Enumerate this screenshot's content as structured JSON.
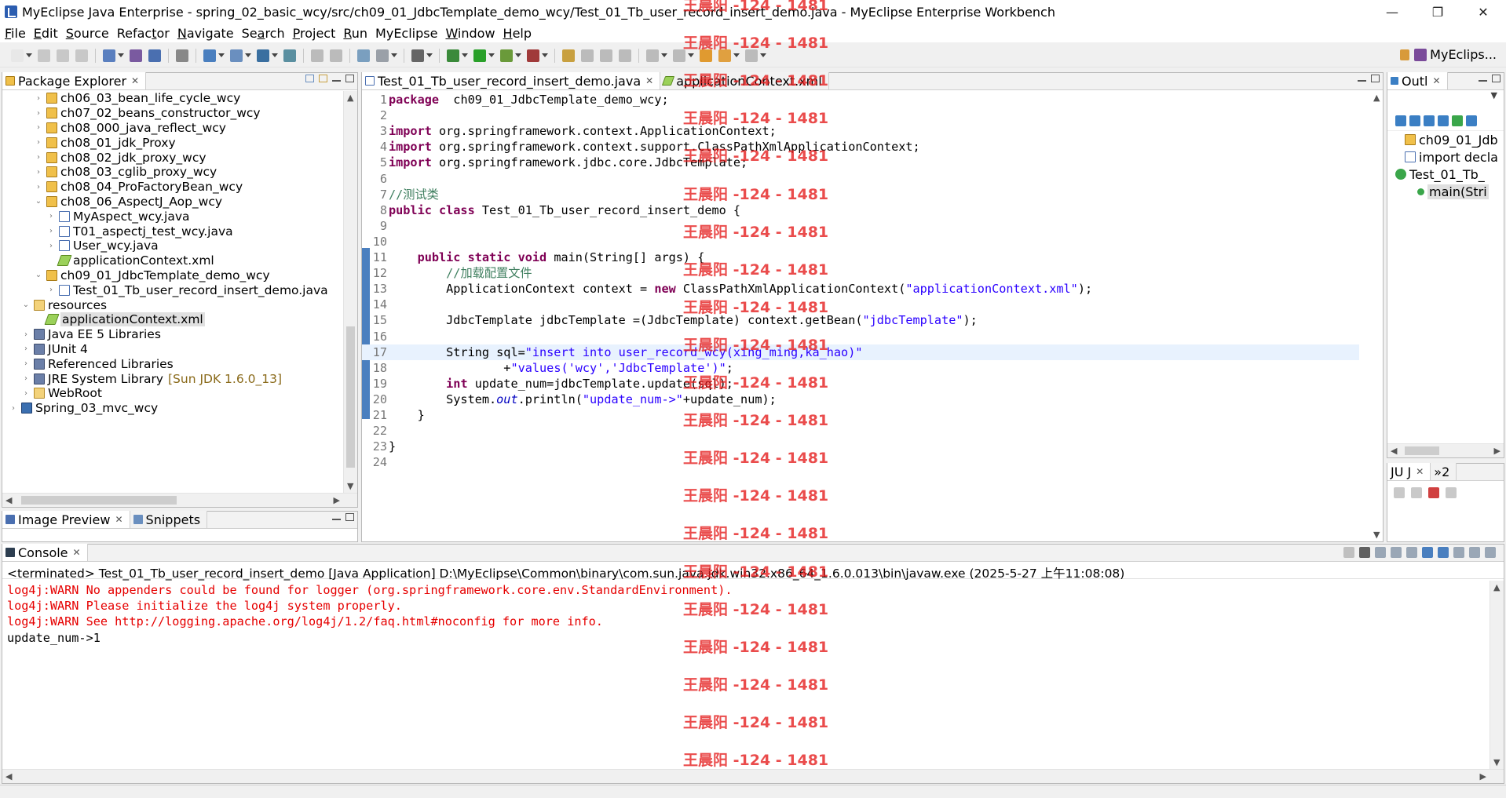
{
  "window": {
    "title": "MyEclipse Java Enterprise - spring_02_basic_wcy/src/ch09_01_JdbcTemplate_demo_wcy/Test_01_Tb_user_record_insert_demo.java - MyEclipse Enterprise Workbench",
    "minimize": "—",
    "restore": "❐",
    "close": "✕"
  },
  "menu": [
    {
      "mn": "F",
      "rest": "ile"
    },
    {
      "mn": "E",
      "rest": "dit"
    },
    {
      "mn": "S",
      "rest": "ource"
    },
    {
      "mn": "",
      "pre": "Refac",
      "mnm": "t",
      "post": "or",
      "rest": ""
    },
    {
      "mn": "N",
      "rest": "avigate"
    },
    {
      "mn": "",
      "pre": "Se",
      "mnm": "a",
      "post": "rch",
      "rest": ""
    },
    {
      "mn": "P",
      "rest": "roject"
    },
    {
      "mn": "R",
      "rest": "un"
    },
    {
      "mn": "",
      "pre": "MyEclipse",
      "mnm": "",
      "post": "",
      "rest": ""
    },
    {
      "mn": "W",
      "rest": "indow"
    },
    {
      "mn": "H",
      "rest": "elp"
    }
  ],
  "perspective": {
    "label": "MyEclips..."
  },
  "colors": {
    "keyword": "#7f0055",
    "string": "#2a00ff",
    "comment": "#3f7f5f",
    "console_warn": "#e60000",
    "watermark": "#e51b1b",
    "current_line": "#e8f2fe"
  },
  "package_explorer": {
    "tab_label": "Package Explorer",
    "items": [
      {
        "label": "ch06_03_bean_life_cycle_wcy",
        "icon": "package-icon",
        "level": 2,
        "twisty": "›"
      },
      {
        "label": "ch07_02_beans_constructor_wcy",
        "icon": "package-icon",
        "level": 2,
        "twisty": "›"
      },
      {
        "label": "ch08_000_java_reflect_wcy",
        "icon": "package-icon",
        "level": 2,
        "twisty": "›"
      },
      {
        "label": "ch08_01_jdk_Proxy",
        "icon": "package-icon",
        "level": 2,
        "twisty": "›"
      },
      {
        "label": "ch08_02_jdk_proxy_wcy",
        "icon": "package-icon",
        "level": 2,
        "twisty": "›"
      },
      {
        "label": "ch08_03_cglib_proxy_wcy",
        "icon": "package-icon",
        "level": 2,
        "twisty": "›"
      },
      {
        "label": "ch08_04_ProFactoryBean_wcy",
        "icon": "package-icon",
        "level": 2,
        "twisty": "›"
      },
      {
        "label": "ch08_06_AspectJ_Aop_wcy",
        "icon": "package-icon",
        "level": 2,
        "twisty": "⌄"
      },
      {
        "label": "MyAspect_wcy.java",
        "icon": "java-file-icon",
        "level": 3,
        "twisty": "›"
      },
      {
        "label": "T01_aspectj_test_wcy.java",
        "icon": "java-file-icon",
        "level": 3,
        "twisty": "›"
      },
      {
        "label": "User_wcy.java",
        "icon": "java-file-icon",
        "level": 3,
        "twisty": "›"
      },
      {
        "label": "applicationContext.xml",
        "icon": "xml-file-icon",
        "level": 3,
        "twisty": ""
      },
      {
        "label": "ch09_01_JdbcTemplate_demo_wcy",
        "icon": "package-icon",
        "level": 2,
        "twisty": "⌄"
      },
      {
        "label": "Test_01_Tb_user_record_insert_demo.java",
        "icon": "java-file-icon",
        "level": 3,
        "twisty": "›"
      },
      {
        "label": "resources",
        "icon": "folder-icon",
        "level": 1,
        "twisty": "⌄"
      },
      {
        "label": "applicationContext.xml",
        "icon": "xml-file-icon",
        "level": 2,
        "twisty": "",
        "selected": true
      },
      {
        "label": "Java EE 5 Libraries",
        "icon": "library-icon",
        "level": 1,
        "twisty": "›"
      },
      {
        "label": "JUnit 4",
        "icon": "library-icon",
        "level": 1,
        "twisty": "›"
      },
      {
        "label": "Referenced Libraries",
        "icon": "library-icon",
        "level": 1,
        "twisty": "›"
      },
      {
        "label": "JRE System Library",
        "extra": "[Sun JDK 1.6.0_13]",
        "icon": "library-icon",
        "level": 1,
        "twisty": "›"
      },
      {
        "label": "WebRoot",
        "icon": "folder-icon",
        "level": 1,
        "twisty": "›"
      },
      {
        "label": "Spring_03_mvc_wcy",
        "icon": "project-icon",
        "level": 0,
        "twisty": "›"
      }
    ]
  },
  "bottom_left": {
    "tabs": [
      "Image Preview",
      "Snippets"
    ]
  },
  "editor": {
    "tabs": [
      {
        "label": "Test_01_Tb_user_record_insert_demo.java",
        "active": true
      },
      {
        "label": "applicationContext.xml",
        "active": false
      }
    ],
    "current_line": 17,
    "lines": [
      {
        "n": "1",
        "segs": [
          [
            "kw",
            "package"
          ],
          [
            "",
            "  ch09_01_JdbcTemplate_demo_wcy;"
          ]
        ]
      },
      {
        "n": "2",
        "segs": []
      },
      {
        "n": "3",
        "segs": [
          [
            "kw",
            "import"
          ],
          [
            "",
            " org.springframework.context.ApplicationContext;"
          ]
        ]
      },
      {
        "n": "4",
        "segs": [
          [
            "kw",
            "import"
          ],
          [
            "",
            " org.springframework.context.support.ClassPathXmlApplicationContext;"
          ]
        ]
      },
      {
        "n": "5",
        "segs": [
          [
            "kw",
            "import"
          ],
          [
            "",
            " org.springframework.jdbc.core.JdbcTemplate;"
          ]
        ]
      },
      {
        "n": "6",
        "segs": []
      },
      {
        "n": "7",
        "segs": [
          [
            "cmt",
            "//测试类"
          ]
        ]
      },
      {
        "n": "8",
        "segs": [
          [
            "kw",
            "public class"
          ],
          [
            "",
            " Test_01_Tb_user_record_insert_demo {"
          ]
        ]
      },
      {
        "n": "9",
        "segs": []
      },
      {
        "n": "10",
        "segs": []
      },
      {
        "n": "11",
        "segs": [
          [
            "",
            "    "
          ],
          [
            "kw",
            "public static void"
          ],
          [
            "",
            " main(String[] args) {"
          ]
        ]
      },
      {
        "n": "12",
        "segs": [
          [
            "",
            "        "
          ],
          [
            "cmt",
            "//加载配置文件"
          ]
        ]
      },
      {
        "n": "13",
        "segs": [
          [
            "",
            "        ApplicationContext context = "
          ],
          [
            "kw",
            "new"
          ],
          [
            "",
            " ClassPathXmlApplicationContext("
          ],
          [
            "str",
            "\"applicationContext.xml\""
          ],
          [
            "",
            ");"
          ]
        ]
      },
      {
        "n": "14",
        "segs": []
      },
      {
        "n": "15",
        "segs": [
          [
            "",
            "        JdbcTemplate jdbcTemplate =(JdbcTemplate) context.getBean("
          ],
          [
            "str",
            "\"jdbcTemplate\""
          ],
          [
            "",
            ");"
          ]
        ]
      },
      {
        "n": "16",
        "segs": []
      },
      {
        "n": "17",
        "segs": [
          [
            "",
            "        String sql="
          ],
          [
            "str",
            "\"insert into user_record_wcy(xing_ming,ka_hao)\""
          ]
        ]
      },
      {
        "n": "18",
        "segs": [
          [
            "",
            "                +"
          ],
          [
            "str",
            "\"values('wcy','JdbcTemplate')\""
          ],
          [
            "",
            ";"
          ]
        ]
      },
      {
        "n": "19",
        "segs": [
          [
            "",
            "        "
          ],
          [
            "kw",
            "int"
          ],
          [
            "",
            " update_num=jdbcTemplate.update(sql);"
          ]
        ]
      },
      {
        "n": "20",
        "segs": [
          [
            "",
            "        System."
          ],
          [
            "st",
            "out"
          ],
          [
            "",
            ".println("
          ],
          [
            "str",
            "\"update_num->\""
          ],
          [
            "",
            "+update_num);"
          ]
        ]
      },
      {
        "n": "21",
        "segs": [
          [
            "",
            "    }"
          ]
        ]
      },
      {
        "n": "22",
        "segs": []
      },
      {
        "n": "23",
        "segs": [
          [
            "",
            "}"
          ]
        ]
      },
      {
        "n": "24",
        "segs": []
      }
    ]
  },
  "outline": {
    "tab_label": "Outl",
    "items": [
      {
        "label": "ch09_01_Jdb",
        "icon": "package-icon"
      },
      {
        "label": "import decla",
        "icon": "imports-icon"
      },
      {
        "label": "Test_01_Tb_",
        "icon": "class-icon"
      },
      {
        "label": "main(Stri",
        "icon": "method-icon",
        "selected": true
      }
    ]
  },
  "junit": {
    "tab_label": "JU J",
    "tab2_label": "»2"
  },
  "console": {
    "tab_label": "Console",
    "header": "<terminated> Test_01_Tb_user_record_insert_demo [Java Application] D:\\MyEclipse\\Common\\binary\\com.sun.java.jdk.win32.x86_64_1.6.0.013\\bin\\javaw.exe (2025-5-27 上午11:08:08)",
    "lines": [
      {
        "text": "log4j:WARN No appenders could be found for logger (org.springframework.core.env.StandardEnvironment).",
        "kind": "warn"
      },
      {
        "text": "log4j:WARN Please initialize the log4j system properly.",
        "kind": "warn"
      },
      {
        "text": "log4j:WARN See http://logging.apache.org/log4j/1.2/faq.html#noconfig for more info.",
        "kind": "warn"
      },
      {
        "text": "update_num->1",
        "kind": "out"
      }
    ]
  },
  "watermark": {
    "text": "王晨阳 -124 - 1481",
    "count": 21
  }
}
